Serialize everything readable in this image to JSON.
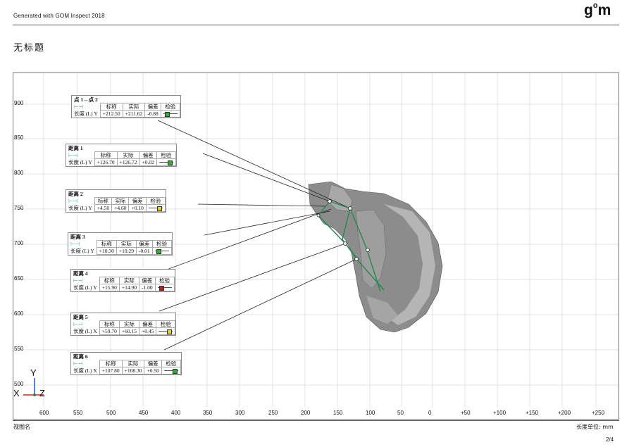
{
  "header": {
    "generated": "Generated with GOM Inspect 2018",
    "logo_main": "g",
    "logo_sup": "o",
    "logo_tail": "m"
  },
  "title": "无标题",
  "view": {
    "y_ticks": [
      "900",
      "850",
      "800",
      "750",
      "700",
      "650",
      "600",
      "550",
      "500"
    ],
    "x_ticks": [
      "600",
      "550",
      "500",
      "450",
      "400",
      "350",
      "300",
      "250",
      "200",
      "150",
      "100",
      "50",
      "0",
      "+50",
      "+100",
      "+150",
      "+200",
      "+250"
    ],
    "axis_labels": {
      "y": "Y",
      "x": "X",
      "z": "Z"
    }
  },
  "columns": {
    "nominal": "标称",
    "actual": "实际",
    "dev": "偏差",
    "check": "检验"
  },
  "cards": [
    {
      "name": "点 1↔点 2",
      "row_label": "长度 (L) Y",
      "nominal": "+212.50",
      "actual": "+211.62",
      "dev": "-0.88",
      "status_color": "#2bb02b"
    },
    {
      "name": "距离 1",
      "row_label": "长度 (L) Y",
      "nominal": "+126.70",
      "actual": "+126.72",
      "dev": "+0.02",
      "status_color": "#2bb02b"
    },
    {
      "name": "距离 2",
      "row_label": "长度 (L) Y",
      "nominal": "+4.50",
      "actual": "+4.60",
      "dev": "+0.10",
      "status_color": "#e8d020"
    },
    {
      "name": "距离 3",
      "row_label": "长度 (L) Y",
      "nominal": "+10.30",
      "actual": "+10.29",
      "dev": "-0.01",
      "status_color": "#2bb02b"
    },
    {
      "name": "距离 4",
      "row_label": "长度 (L) Y",
      "nominal": "+15.90",
      "actual": "+14.90",
      "dev": "-1.00",
      "status_color": "#cc1a1a"
    },
    {
      "name": "距离 5",
      "row_label": "长度 (L) X",
      "nominal": "+59.70",
      "actual": "+60.15",
      "dev": "+0.45",
      "status_color": "#e8d020"
    },
    {
      "name": "距离 6",
      "row_label": "长度 (L) X",
      "nominal": "+107.80",
      "actual": "+108.30",
      "dev": "+0.50",
      "status_color": "#2bb02b"
    }
  ],
  "footer": {
    "left": "视图名",
    "right": "长度单位: mm",
    "page": "2/4"
  }
}
